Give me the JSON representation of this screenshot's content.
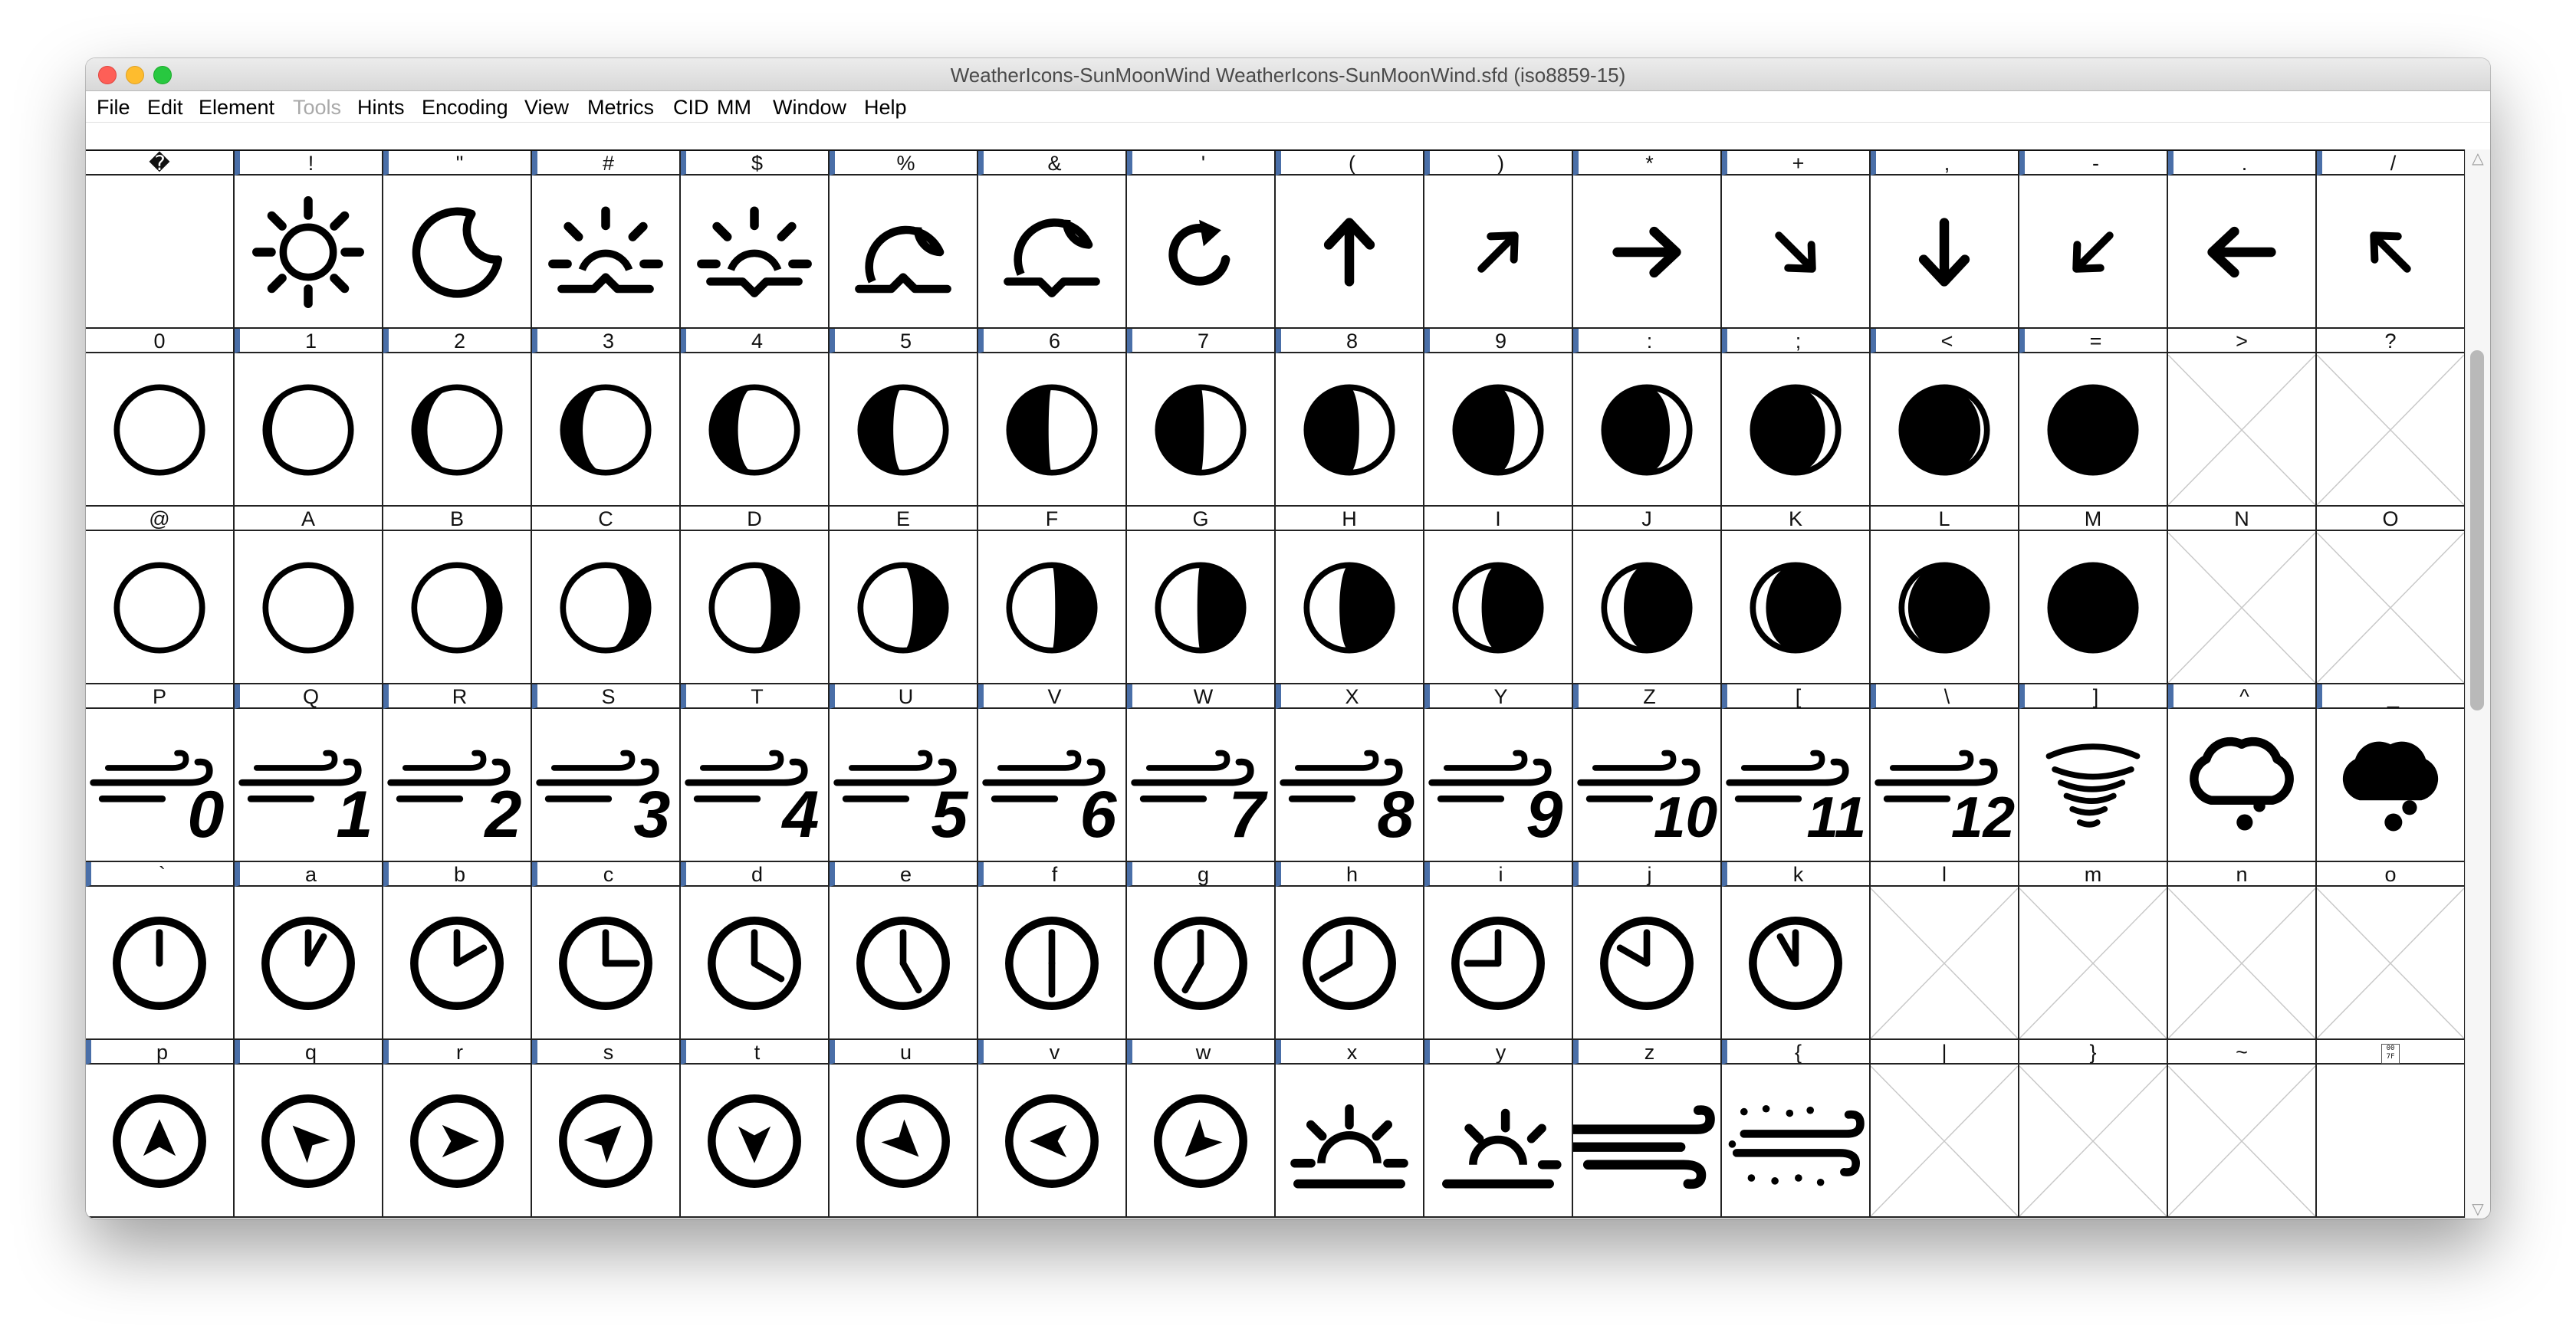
{
  "window": {
    "title": "WeatherIcons-SunMoonWind  WeatherIcons-SunMoonWind.sfd (iso8859-15)"
  },
  "menu": [
    {
      "label": "File",
      "enabled": true
    },
    {
      "label": "Edit",
      "enabled": true
    },
    {
      "label": "Element",
      "enabled": true
    },
    {
      "label": "Tools",
      "enabled": false
    },
    {
      "label": "Hints",
      "enabled": true
    },
    {
      "label": "Encoding",
      "enabled": true
    },
    {
      "label": "View",
      "enabled": true
    },
    {
      "label": "Metrics",
      "enabled": true
    },
    {
      "label": "CID",
      "enabled": true
    },
    {
      "label": "MM",
      "enabled": true
    },
    {
      "label": "Window",
      "enabled": true
    },
    {
      "label": "Help",
      "enabled": true
    }
  ],
  "grid": {
    "rows": [
      {
        "cells": [
          {
            "label": "�",
            "glyph": "blank",
            "selected": false
          },
          {
            "label": "!",
            "glyph": "sun",
            "selected": true
          },
          {
            "label": "\"",
            "glyph": "moon-crescent",
            "selected": true
          },
          {
            "label": "#",
            "glyph": "sunrise-up",
            "selected": true
          },
          {
            "label": "$",
            "glyph": "sunset-down",
            "selected": true
          },
          {
            "label": "%",
            "glyph": "moonrise-up",
            "selected": true
          },
          {
            "label": "&",
            "glyph": "moonset-down",
            "selected": true
          },
          {
            "label": "'",
            "glyph": "refresh",
            "selected": true
          },
          {
            "label": "(",
            "glyph": "arrow-up",
            "selected": true
          },
          {
            "label": ")",
            "glyph": "arrow-up-right",
            "selected": true
          },
          {
            "label": "*",
            "glyph": "arrow-right",
            "selected": true
          },
          {
            "label": "+",
            "glyph": "arrow-down-right",
            "selected": true
          },
          {
            "label": ",",
            "glyph": "arrow-down",
            "selected": true
          },
          {
            "label": "-",
            "glyph": "arrow-down-left",
            "selected": true
          },
          {
            "label": ".",
            "glyph": "arrow-left",
            "selected": true
          },
          {
            "label": "/",
            "glyph": "arrow-up-left",
            "selected": true
          }
        ]
      },
      {
        "cells": [
          {
            "label": "0",
            "glyph": "moon-phase-0",
            "selected": false
          },
          {
            "label": "1",
            "glyph": "moon-phase-1",
            "selected": true
          },
          {
            "label": "2",
            "glyph": "moon-phase-2",
            "selected": true
          },
          {
            "label": "3",
            "glyph": "moon-phase-3",
            "selected": true
          },
          {
            "label": "4",
            "glyph": "moon-phase-4",
            "selected": true
          },
          {
            "label": "5",
            "glyph": "moon-phase-5",
            "selected": true
          },
          {
            "label": "6",
            "glyph": "moon-phase-6",
            "selected": true
          },
          {
            "label": "7",
            "glyph": "moon-phase-7",
            "selected": true
          },
          {
            "label": "8",
            "glyph": "moon-phase-8",
            "selected": true
          },
          {
            "label": "9",
            "glyph": "moon-phase-9",
            "selected": true
          },
          {
            "label": ":",
            "glyph": "moon-phase-10",
            "selected": true
          },
          {
            "label": ";",
            "glyph": "moon-phase-11",
            "selected": true
          },
          {
            "label": "<",
            "glyph": "moon-phase-12",
            "selected": true
          },
          {
            "label": "=",
            "glyph": "moon-phase-13",
            "selected": true
          },
          {
            "label": ">",
            "glyph": "empty",
            "selected": false
          },
          {
            "label": "?",
            "glyph": "empty",
            "selected": false
          }
        ]
      },
      {
        "cells": [
          {
            "label": "@",
            "glyph": "moon-phase-14",
            "selected": false
          },
          {
            "label": "A",
            "glyph": "moon-phase-15",
            "selected": false
          },
          {
            "label": "B",
            "glyph": "moon-phase-16",
            "selected": false
          },
          {
            "label": "C",
            "glyph": "moon-phase-17",
            "selected": false
          },
          {
            "label": "D",
            "glyph": "moon-phase-18",
            "selected": false
          },
          {
            "label": "E",
            "glyph": "moon-phase-19",
            "selected": false
          },
          {
            "label": "F",
            "glyph": "moon-phase-20",
            "selected": false
          },
          {
            "label": "G",
            "glyph": "moon-phase-21",
            "selected": false
          },
          {
            "label": "H",
            "glyph": "moon-phase-22",
            "selected": false
          },
          {
            "label": "I",
            "glyph": "moon-phase-23",
            "selected": false
          },
          {
            "label": "J",
            "glyph": "moon-phase-24",
            "selected": false
          },
          {
            "label": "K",
            "glyph": "moon-phase-25",
            "selected": false
          },
          {
            "label": "L",
            "glyph": "moon-phase-26",
            "selected": false
          },
          {
            "label": "M",
            "glyph": "moon-phase-27",
            "selected": false
          },
          {
            "label": "N",
            "glyph": "empty",
            "selected": false
          },
          {
            "label": "O",
            "glyph": "empty",
            "selected": false
          }
        ]
      },
      {
        "cells": [
          {
            "label": "P",
            "glyph": "wind-0",
            "selected": false
          },
          {
            "label": "Q",
            "glyph": "wind-1",
            "selected": true
          },
          {
            "label": "R",
            "glyph": "wind-2",
            "selected": true
          },
          {
            "label": "S",
            "glyph": "wind-3",
            "selected": true
          },
          {
            "label": "T",
            "glyph": "wind-4",
            "selected": true
          },
          {
            "label": "U",
            "glyph": "wind-5",
            "selected": true
          },
          {
            "label": "V",
            "glyph": "wind-6",
            "selected": true
          },
          {
            "label": "W",
            "glyph": "wind-7",
            "selected": true
          },
          {
            "label": "X",
            "glyph": "wind-8",
            "selected": true
          },
          {
            "label": "Y",
            "glyph": "wind-9",
            "selected": true
          },
          {
            "label": "Z",
            "glyph": "wind-10",
            "selected": true
          },
          {
            "label": "[",
            "glyph": "wind-11",
            "selected": true
          },
          {
            "label": "\\",
            "glyph": "wind-12",
            "selected": true
          },
          {
            "label": "]",
            "glyph": "tornado",
            "selected": true
          },
          {
            "label": "^",
            "glyph": "cloud-outline",
            "selected": true
          },
          {
            "label": "_",
            "glyph": "cloud-filled",
            "selected": true
          }
        ]
      },
      {
        "cells": [
          {
            "label": "`",
            "glyph": "clock-0",
            "selected": true
          },
          {
            "label": "a",
            "glyph": "clock-1",
            "selected": true
          },
          {
            "label": "b",
            "glyph": "clock-2",
            "selected": true
          },
          {
            "label": "c",
            "glyph": "clock-3",
            "selected": true
          },
          {
            "label": "d",
            "glyph": "clock-4",
            "selected": true
          },
          {
            "label": "e",
            "glyph": "clock-5",
            "selected": true
          },
          {
            "label": "f",
            "glyph": "clock-6",
            "selected": true
          },
          {
            "label": "g",
            "glyph": "clock-7",
            "selected": true
          },
          {
            "label": "h",
            "glyph": "clock-8",
            "selected": true
          },
          {
            "label": "i",
            "glyph": "clock-9",
            "selected": true
          },
          {
            "label": "j",
            "glyph": "clock-10",
            "selected": true
          },
          {
            "label": "k",
            "glyph": "clock-11",
            "selected": true
          },
          {
            "label": "l",
            "glyph": "empty",
            "selected": false
          },
          {
            "label": "m",
            "glyph": "empty",
            "selected": false
          },
          {
            "label": "n",
            "glyph": "empty",
            "selected": false
          },
          {
            "label": "o",
            "glyph": "empty",
            "selected": false
          }
        ]
      },
      {
        "cells": [
          {
            "label": "p",
            "glyph": "compass-n",
            "selected": true
          },
          {
            "label": "q",
            "glyph": "compass-nw",
            "selected": true
          },
          {
            "label": "r",
            "glyph": "compass-e",
            "selected": true
          },
          {
            "label": "s",
            "glyph": "compass-ne",
            "selected": true
          },
          {
            "label": "t",
            "glyph": "compass-s",
            "selected": true
          },
          {
            "label": "u",
            "glyph": "compass-se",
            "selected": true
          },
          {
            "label": "v",
            "glyph": "compass-w",
            "selected": true
          },
          {
            "label": "w",
            "glyph": "compass-sw",
            "selected": true
          },
          {
            "label": "x",
            "glyph": "sunrise",
            "selected": true
          },
          {
            "label": "y",
            "glyph": "sunset",
            "selected": true
          },
          {
            "label": "z",
            "glyph": "wind-strong",
            "selected": true
          },
          {
            "label": "{",
            "glyph": "wind-dust",
            "selected": true
          },
          {
            "label": "|",
            "glyph": "empty",
            "selected": false
          },
          {
            "label": "}",
            "glyph": "empty",
            "selected": false
          },
          {
            "label": "~",
            "glyph": "empty",
            "selected": false
          },
          {
            "label": "",
            "glyph": "unicode-box",
            "selected": false
          }
        ]
      }
    ]
  }
}
